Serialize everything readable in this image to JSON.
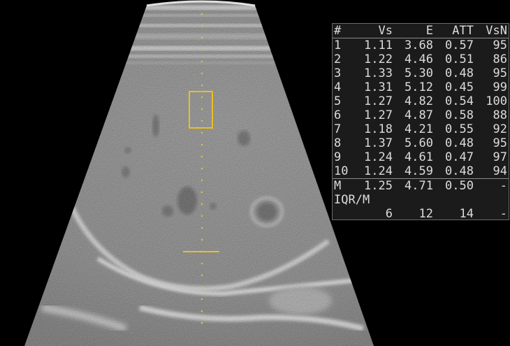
{
  "measurements": {
    "headers": [
      "#",
      "Vs",
      "E",
      "ATT",
      "VsN"
    ],
    "rows": [
      [
        "1",
        "1.11",
        "3.68",
        "0.57",
        "95"
      ],
      [
        "2",
        "1.22",
        "4.46",
        "0.51",
        "86"
      ],
      [
        "3",
        "1.33",
        "5.30",
        "0.48",
        "95"
      ],
      [
        "4",
        "1.31",
        "5.12",
        "0.45",
        "99"
      ],
      [
        "5",
        "1.27",
        "4.82",
        "0.54",
        "100"
      ],
      [
        "6",
        "1.27",
        "4.87",
        "0.58",
        "88"
      ],
      [
        "7",
        "1.18",
        "4.21",
        "0.55",
        "92"
      ],
      [
        "8",
        "1.37",
        "5.60",
        "0.48",
        "95"
      ],
      [
        "9",
        "1.24",
        "4.61",
        "0.47",
        "97"
      ],
      [
        "10",
        "1.24",
        "4.59",
        "0.48",
        "94"
      ]
    ],
    "mean_row": [
      "M",
      "1.25",
      "4.71",
      "0.50",
      "-"
    ],
    "iqr_label": "IQR/M",
    "iqr_row": [
      "",
      "6",
      "12",
      "14",
      "-"
    ]
  },
  "colors": {
    "roi_box": "#e8c020",
    "depth_markers": "#d8c040",
    "panel_bg": "#1b1b1b",
    "panel_text": "#dcdcdc"
  }
}
